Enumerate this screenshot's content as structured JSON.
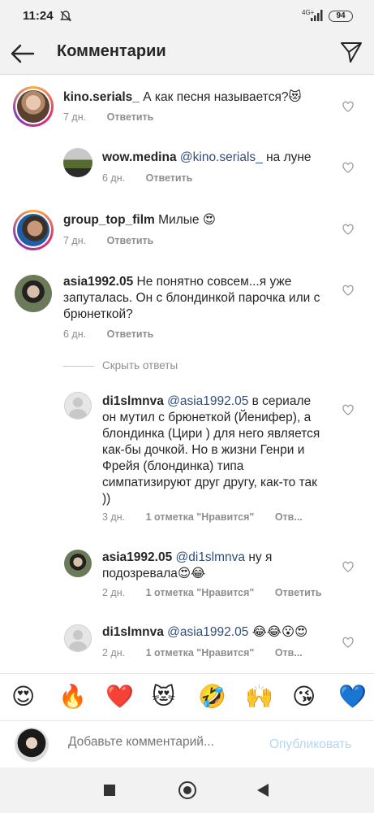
{
  "status": {
    "time": "11:24",
    "network": "4G+",
    "battery": "94"
  },
  "header": {
    "title": "Комментарии",
    "back_icon": "arrow-left-icon",
    "send_icon": "paper-plane-icon"
  },
  "comments": [
    {
      "user": "kino.serials_",
      "text": "А как песня называется?😻",
      "time": "7 дн.",
      "reply": "Ответить"
    },
    {
      "user": "wow.medina",
      "mention": "@kino.serials_",
      "text": " на луне",
      "time": "6 дн.",
      "reply": "Ответить"
    },
    {
      "user": "group_top_film",
      "text": "Милые 😍",
      "time": "7 дн.",
      "reply": "Ответить"
    },
    {
      "user": "asia1992.05",
      "text": "Не понятно совсем...я уже запуталась. Он с блондинкой парочка или с брюнеткой?",
      "time": "6 дн.",
      "reply": "Ответить"
    },
    {
      "user": "di1slmnva",
      "mention": "@asia1992.05",
      "text": " в сериале он мутил с брюнеткой (Йенифер), а блондинка (Цири ) для него является как-бы дочкой. Но в жизни Генри и Фрейя (блондинка) типа симпатизируют друг другу, как-то так ))",
      "time": "3 дн.",
      "likes": "1 отметка \"Нравится\"",
      "reply": "Отв..."
    },
    {
      "user": "asia1992.05",
      "mention": "@di1slmnva",
      "text": " ну я подозревала😍😂",
      "time": "2 дн.",
      "likes": "1 отметка \"Нравится\"",
      "reply": "Ответить"
    },
    {
      "user": "di1slmnva",
      "mention": "@asia1992.05",
      "text": " 😂😂😮😍",
      "time": "2 дн.",
      "likes": "1 отметка \"Нравится\"",
      "reply": "Отв..."
    }
  ],
  "hide_replies": "Скрыть ответы",
  "emoji_bar": [
    "😍",
    "🔥",
    "❤️",
    "😻",
    "🤣",
    "🙌",
    "😘",
    "💙"
  ],
  "input": {
    "placeholder": "Добавьте комментарий...",
    "publish": "Опубликовать"
  }
}
